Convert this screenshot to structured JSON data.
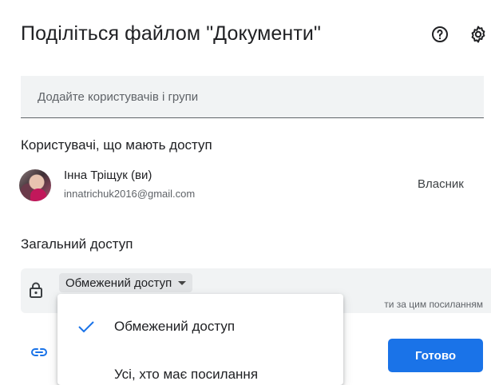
{
  "dialog": {
    "title": "Поділіться файлом \"Документи\"",
    "help_icon": "help-circle-icon",
    "settings_icon": "gear-icon"
  },
  "add_people": {
    "placeholder": "Додайте користувачів і групи",
    "value": ""
  },
  "people_section": {
    "heading": "Користувачі, що мають доступ",
    "users": [
      {
        "name": "Інна Тріщук (ви)",
        "email": "innatrichuk2016@gmail.com",
        "role": "Власник"
      }
    ]
  },
  "general_access": {
    "heading": "Загальний доступ",
    "lock_icon": "lock-icon",
    "selected": "Обмежений доступ",
    "description_visible": "ти за цим посиланням",
    "options": [
      {
        "label": "Обмежений доступ",
        "checked": true
      },
      {
        "label": "Усі, хто має посилання",
        "checked": false
      }
    ]
  },
  "footer": {
    "copy_link_icon": "link-icon",
    "done_label": "Готово"
  },
  "colors": {
    "accent": "#1a73e8",
    "field_bg": "#f1f3f4",
    "check": "#1a73e8"
  }
}
